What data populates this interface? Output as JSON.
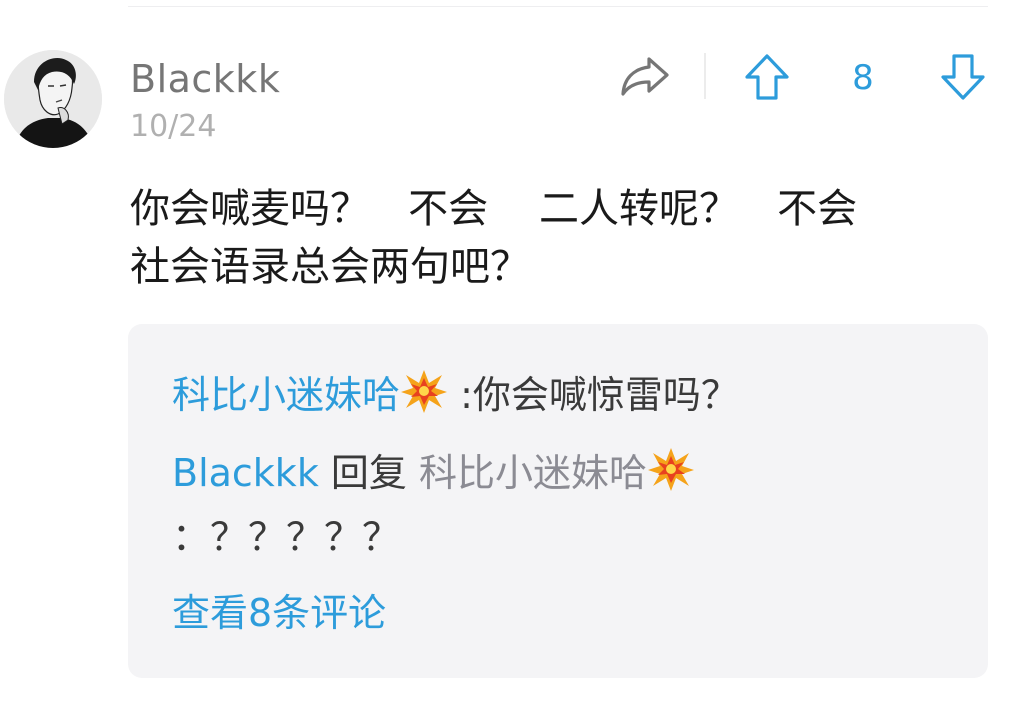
{
  "comment": {
    "username": "Blackkk",
    "date": "10/24",
    "vote_count": "8",
    "text_line1": "你会喊麦吗？   不会    二人转呢？   不会",
    "text_line2": "社会语录总会两句吧？"
  },
  "icons": {
    "share": "share-arrow-icon",
    "upvote": "up-arrow-outline-icon",
    "downvote": "down-arrow-outline-icon",
    "emoji": "collision-emoji"
  },
  "replies": [
    {
      "author": "科比小迷妹哈",
      "separator": " :",
      "text": "你会喊惊雷吗？"
    },
    {
      "author": "Blackkk",
      "reply_word": " 回复 ",
      "reply_to": "科比小迷妹哈",
      "text_cont": "：？？？？？"
    }
  ],
  "view_all": "查看8条评论",
  "colors": {
    "accent_blue": "#2d9cdb",
    "username_gray": "#767676",
    "date_gray": "#b0b0b0",
    "reply_bg": "#f4f4f6",
    "mention_gray": "#8b8b93"
  }
}
